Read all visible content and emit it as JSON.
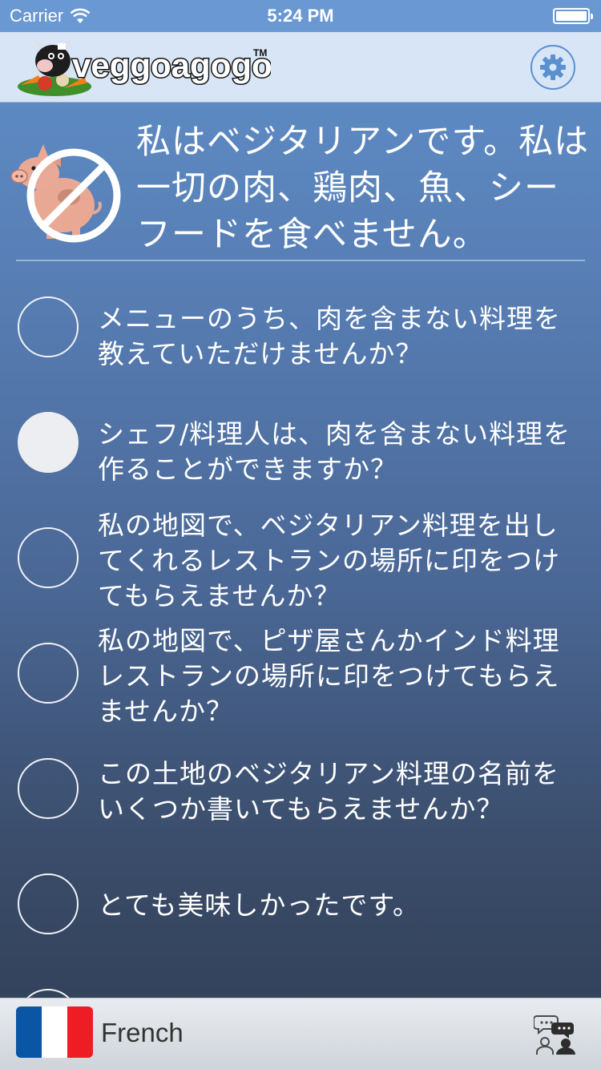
{
  "status_bar": {
    "carrier": "Carrier",
    "time": "5:24 PM"
  },
  "header": {
    "app_name": "veggoagogo",
    "trademark": "TM"
  },
  "statement": "私はベジタリアンです。私は一切の肉、鶏肉、魚、シーフードを食べません。",
  "questions": [
    {
      "text": "メニューのうち、肉を含まない料理を教えていただけませんか？",
      "selected": false
    },
    {
      "text": "シェフ/料理人は、肉を含まない料理を作ることができますか？",
      "selected": true
    },
    {
      "text": "私の地図で、ベジタリアン料理を出してくれるレストランの場所に印をつけてもらえませんか？",
      "selected": false
    },
    {
      "text": "私の地図で、ピザ屋さんかインド料理レストランの場所に印をつけてもらえませんか？",
      "selected": false
    },
    {
      "text": "この土地のベジタリアン料理の名前をいくつか書いてもらえませんか？",
      "selected": false
    },
    {
      "text": "とても美味しかったです。",
      "selected": false
    }
  ],
  "bottom_bar": {
    "language": "French",
    "flag_colors": [
      "#0a55a4",
      "#ffffff",
      "#ee1c25"
    ]
  },
  "colors": {
    "header_bg": "#d7e5f6",
    "accent": "#5a8fd0",
    "selected_radio": "#eceef1"
  }
}
